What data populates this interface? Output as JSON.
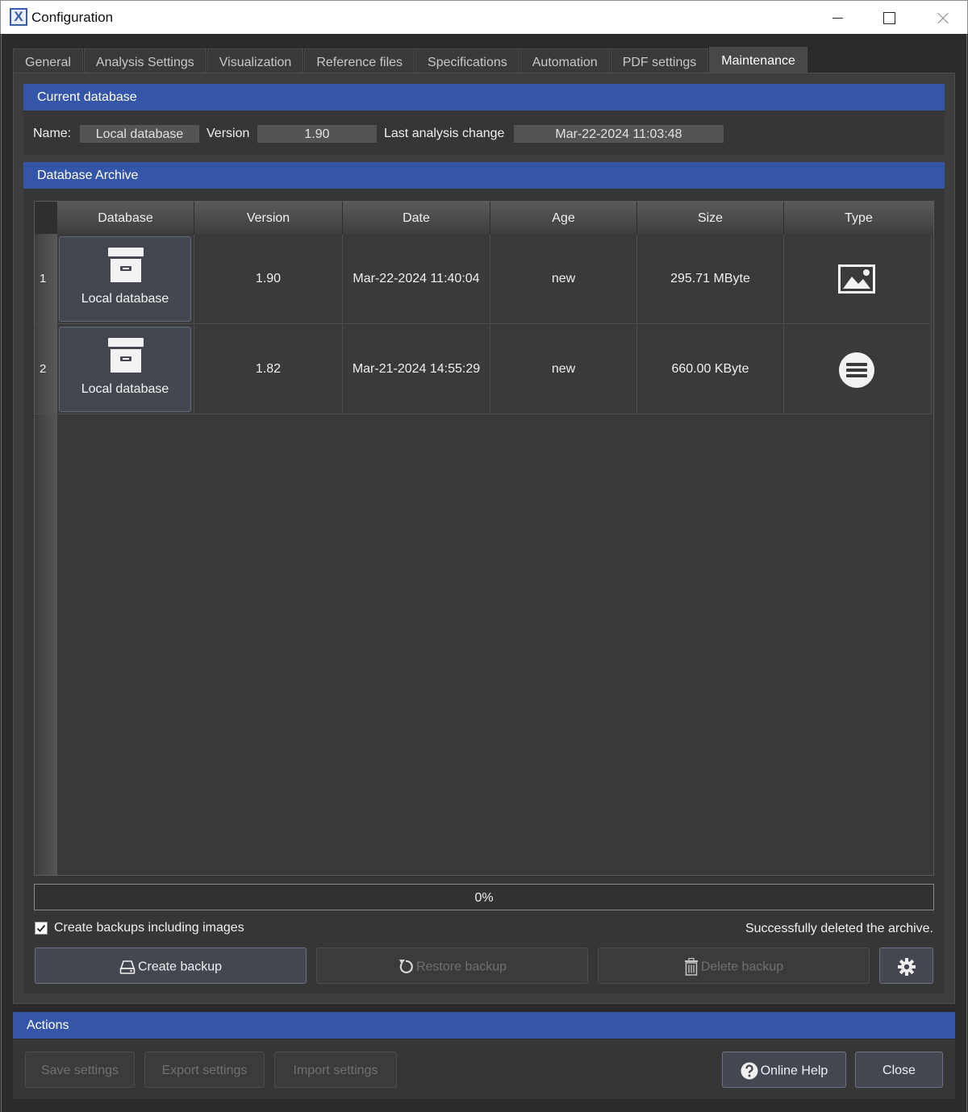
{
  "window": {
    "title": "Configuration",
    "icon_letter": "X"
  },
  "tabs": [
    {
      "label": "General"
    },
    {
      "label": "Analysis Settings"
    },
    {
      "label": "Visualization"
    },
    {
      "label": "Reference files"
    },
    {
      "label": "Specifications"
    },
    {
      "label": "Automation"
    },
    {
      "label": "PDF settings"
    },
    {
      "label": "Maintenance",
      "active": true
    }
  ],
  "current_db": {
    "header": "Current database",
    "name_label": "Name:",
    "name_value": "Local database",
    "version_label": "Version",
    "version_value": "1.90",
    "change_label": "Last analysis change",
    "change_value": "Mar-22-2024 11:03:48"
  },
  "archive": {
    "header": "Database Archive",
    "columns": [
      "Database",
      "Version",
      "Date",
      "Age",
      "Size",
      "Type"
    ],
    "rows": [
      {
        "num": "1",
        "database": "Local database",
        "version": "1.90",
        "date": "Mar-22-2024 11:40:04",
        "age": "new",
        "size": "295.71 MByte",
        "type_icon": "image-icon"
      },
      {
        "num": "2",
        "database": "Local database",
        "version": "1.82",
        "date": "Mar-21-2024 14:55:29",
        "age": "new",
        "size": "660.00 KByte",
        "type_icon": "list-circle-icon"
      }
    ],
    "progress_percent": 0,
    "progress_text": "0%",
    "include_images_label": "Create backups including images",
    "include_images_checked": true,
    "status_text": "Successfully deleted the archive.",
    "create_label": "Create backup",
    "restore_label": "Restore backup",
    "delete_label": "Delete backup"
  },
  "actions": {
    "header": "Actions",
    "save_label": "Save settings",
    "export_label": "Export settings",
    "import_label": "Import settings",
    "help_label": "Online Help",
    "close_label": "Close"
  },
  "colors": {
    "accent": "#3556a8",
    "background": "#2b2b2b",
    "panel": "#3e3e3e"
  }
}
